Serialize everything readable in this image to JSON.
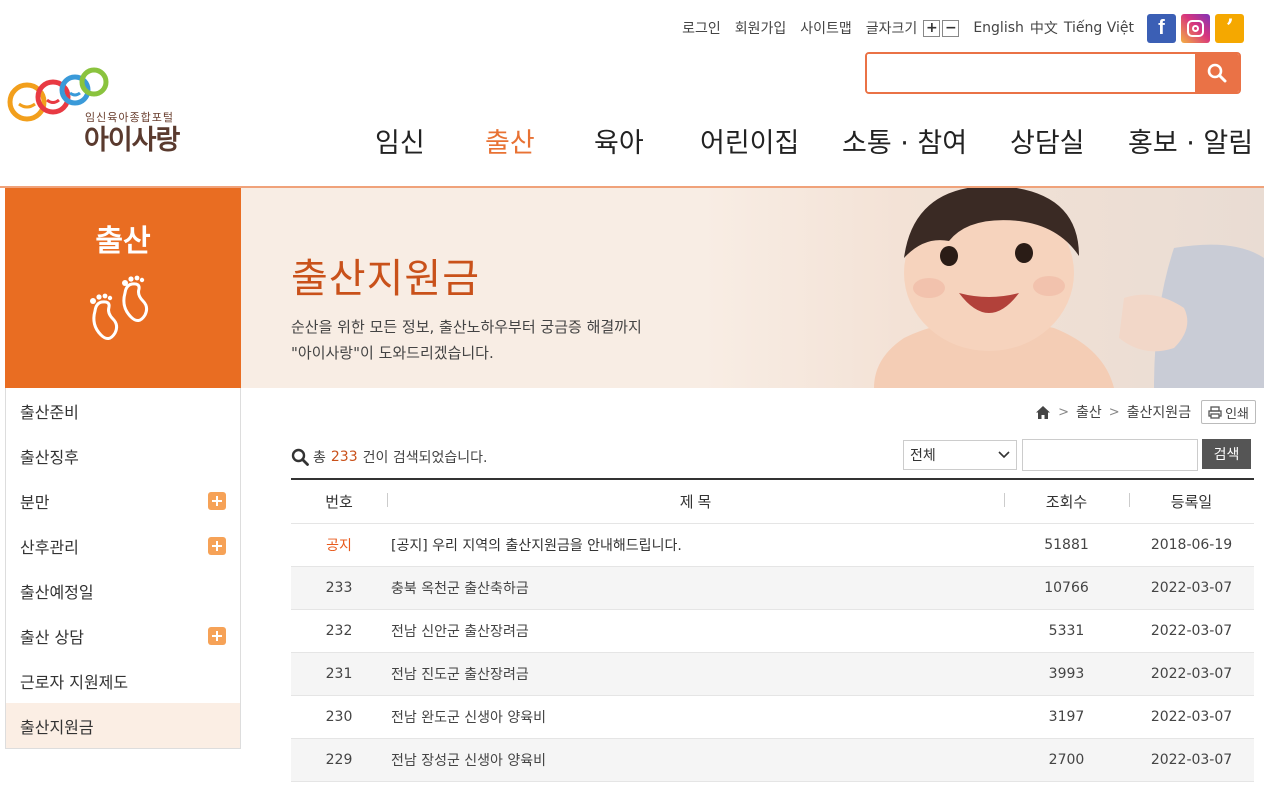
{
  "util": {
    "login": "로그인",
    "signup": "회원가입",
    "sitemap": "사이트맵",
    "fontsize_label": "글자크기",
    "fontsize_plus": "+",
    "fontsize_minus": "−",
    "lang_en": "English",
    "lang_zh": "中文",
    "lang_vi": "Tiếng Việt"
  },
  "sns": [
    {
      "icon": "facebook-icon",
      "glyph": "f"
    },
    {
      "icon": "instagram-icon",
      "glyph": ""
    },
    {
      "icon": "kakaostory-icon",
      "glyph": "ʼ"
    }
  ],
  "search": {
    "placeholder": ""
  },
  "logo": {
    "sub": "임신육아종합포털",
    "main": "아이사랑"
  },
  "gnb": [
    {
      "label": "임신",
      "active": false
    },
    {
      "label": "출산",
      "active": true
    },
    {
      "label": "육아",
      "active": false
    },
    {
      "label": "어린이집",
      "active": false
    },
    {
      "label": "소통 · 참여",
      "active": false
    },
    {
      "label": "상담실",
      "active": false
    },
    {
      "label": "홍보 · 알림",
      "active": false
    }
  ],
  "sidebar": {
    "title": "출산",
    "items": [
      {
        "label": "출산준비",
        "expandable": false,
        "active": false
      },
      {
        "label": "출산징후",
        "expandable": false,
        "active": false
      },
      {
        "label": "분만",
        "expandable": true,
        "active": false
      },
      {
        "label": "산후관리",
        "expandable": true,
        "active": false
      },
      {
        "label": "출산예정일",
        "expandable": false,
        "active": false
      },
      {
        "label": "출산 상담",
        "expandable": true,
        "active": false
      },
      {
        "label": "근로자 지원제도",
        "expandable": false,
        "active": false
      },
      {
        "label": "출산지원금",
        "expandable": false,
        "active": true
      }
    ]
  },
  "banner": {
    "title": "출산지원금",
    "desc": "순산을 위한 모든 정보, 출산노하우부터 궁금증 해결까지\n\"아이사랑\"이 도와드리겠습니다."
  },
  "breadcrumb": {
    "level1": "출산",
    "level2": "출산지원금",
    "print": "인쇄"
  },
  "result": {
    "prefix": "총",
    "count": "233",
    "suffix": "건이 검색되었습니다."
  },
  "filter": {
    "selected": "전체",
    "button": "검색"
  },
  "table": {
    "headers": {
      "no": "번호",
      "title": "제목",
      "views": "조회수",
      "date": "등록일"
    },
    "rows": [
      {
        "no": "공지",
        "title": "[공지] 우리 지역의 출산지원금을 안내해드립니다.",
        "views": "51881",
        "date": "2018-06-19"
      },
      {
        "no": "233",
        "title": "충북 옥천군 출산축하금",
        "views": "10766",
        "date": "2022-03-07"
      },
      {
        "no": "232",
        "title": "전남 신안군 출산장려금",
        "views": "5331",
        "date": "2022-03-07"
      },
      {
        "no": "231",
        "title": "전남 진도군 출산장려금",
        "views": "3993",
        "date": "2022-03-07"
      },
      {
        "no": "230",
        "title": "전남 완도군 신생아 양육비",
        "views": "3197",
        "date": "2022-03-07"
      },
      {
        "no": "229",
        "title": "전남 장성군 신생아 양육비",
        "views": "2700",
        "date": "2022-03-07"
      }
    ]
  }
}
